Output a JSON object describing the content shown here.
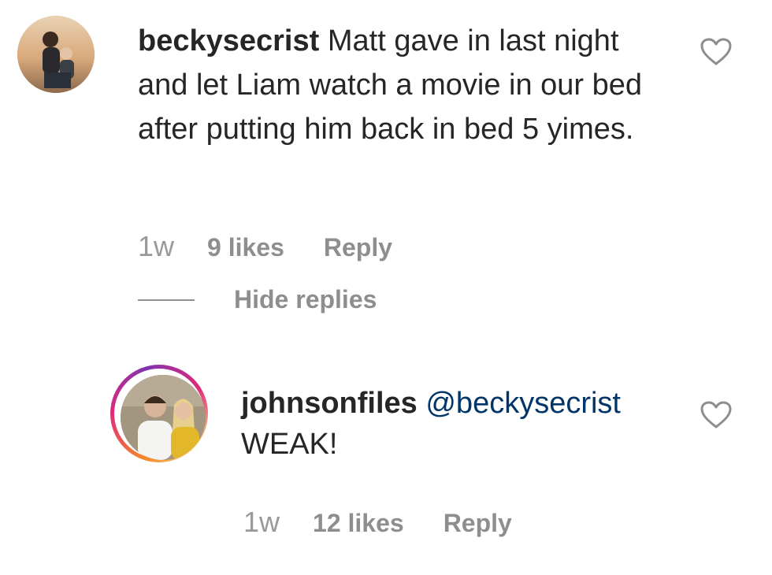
{
  "comments": [
    {
      "username": "beckysecrist",
      "text": " Matt gave in last night and let Liam watch a movie in our bed after putting him back in bed 5 yimes.",
      "time": "1w",
      "likes": "9 likes",
      "reply_label": "Reply"
    },
    {
      "username": "johnsonfiles",
      "mention": "@beckysecrist",
      "text": "WEAK!",
      "time": "1w",
      "likes": "12 likes",
      "reply_label": "Reply"
    }
  ],
  "hide_replies_label": "Hide replies",
  "colors": {
    "text": "#262626",
    "meta": "#8e8e8e",
    "mention": "#003569"
  },
  "icons": [
    "heart-icon"
  ]
}
